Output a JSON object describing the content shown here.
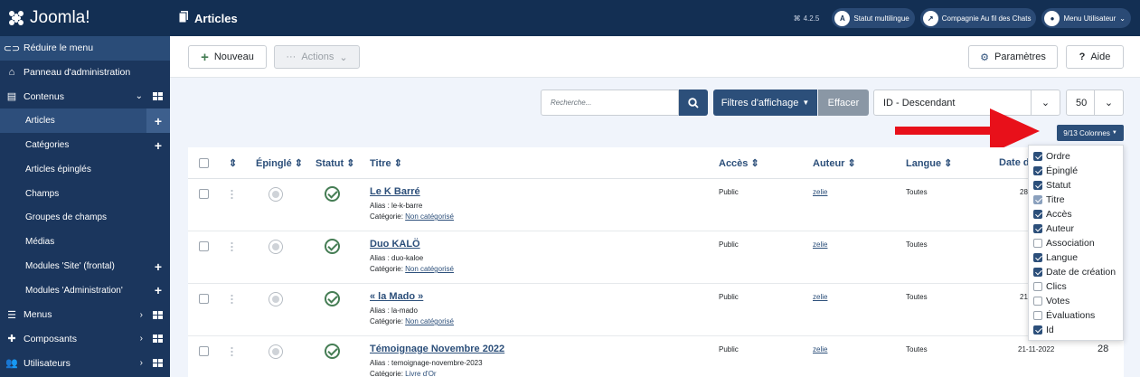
{
  "header": {
    "brand": "Joomla!",
    "page_title": "Articles",
    "version": "4.2.5",
    "multilingual": "Statut multilingue",
    "site": "Compagnie Au fil des Chats",
    "user_menu": "Menu Utilisateur"
  },
  "sidebar": {
    "items": [
      {
        "label": "Réduire le menu",
        "icon": "toggle-icon"
      },
      {
        "label": "Panneau d'administration",
        "icon": "home-icon"
      },
      {
        "label": "Contenus",
        "icon": "file-icon"
      },
      {
        "label": "Articles"
      },
      {
        "label": "Catégories"
      },
      {
        "label": "Articles épinglés"
      },
      {
        "label": "Champs"
      },
      {
        "label": "Groupes de champs"
      },
      {
        "label": "Médias"
      },
      {
        "label": "Modules 'Site' (frontal)"
      },
      {
        "label": "Modules 'Administration'"
      },
      {
        "label": "Menus",
        "icon": "list-icon"
      },
      {
        "label": "Composants",
        "icon": "puzzle-icon"
      },
      {
        "label": "Utilisateurs",
        "icon": "users-icon"
      }
    ]
  },
  "toolbar": {
    "new_label": "Nouveau",
    "actions_label": "Actions",
    "params_label": "Paramètres",
    "help_label": "Aide"
  },
  "filters": {
    "search_placeholder": "Recherche...",
    "filter_label": "Filtres d'affichage",
    "clear_label": "Effacer",
    "order_value": "ID - Descendant",
    "limit_value": "50",
    "columns_label": "9/13 Colonnes"
  },
  "table": {
    "headers": {
      "pinned": "Épinglé",
      "status": "Statut",
      "title": "Titre",
      "access": "Accès",
      "author": "Auteur",
      "language": "Langue",
      "date": "Date d"
    },
    "alias_prefix": "Alias :",
    "category_prefix": "Catégorie:",
    "rows": [
      {
        "title": "Le K Barré",
        "alias": "le-k-barre",
        "category": "Non catégorisé",
        "access": "Public",
        "author": "zelie",
        "language": "Toutes",
        "date": "28",
        "id": ""
      },
      {
        "title": "Duo KALÖ",
        "alias": "duo-kaloe",
        "category": "Non catégorisé",
        "access": "Public",
        "author": "zelie",
        "language": "Toutes",
        "date": "",
        "id": ""
      },
      {
        "title": "« la Mado »",
        "alias": "la-mado",
        "category": "Non catégorisé",
        "access": "Public",
        "author": "zelie",
        "language": "Toutes",
        "date": "21",
        "id": ""
      },
      {
        "title": "Témoignage Novembre 2022",
        "alias": "temoignage-novembre-2023",
        "category": "Livre d'Or",
        "access": "Public",
        "author": "zelie",
        "language": "Toutes",
        "date": "21-11-2022",
        "id": "28"
      }
    ]
  },
  "columns_dropdown": [
    {
      "label": "Ordre",
      "checked": true
    },
    {
      "label": "Épinglé",
      "checked": true
    },
    {
      "label": "Statut",
      "checked": true
    },
    {
      "label": "Titre",
      "checked": true,
      "disabled": true
    },
    {
      "label": "Accès",
      "checked": true
    },
    {
      "label": "Auteur",
      "checked": true
    },
    {
      "label": "Association",
      "checked": false
    },
    {
      "label": "Langue",
      "checked": true
    },
    {
      "label": "Date de création",
      "checked": true
    },
    {
      "label": "Clics",
      "checked": false
    },
    {
      "label": "Votes",
      "checked": false
    },
    {
      "label": "Évaluations",
      "checked": false
    },
    {
      "label": "Id",
      "checked": true
    }
  ],
  "colors": {
    "header_bg": "#132f53",
    "sidebar_bg": "#1b365d",
    "primary": "#2c4f7a",
    "success": "#457d54",
    "arrow": "#e8101a"
  }
}
